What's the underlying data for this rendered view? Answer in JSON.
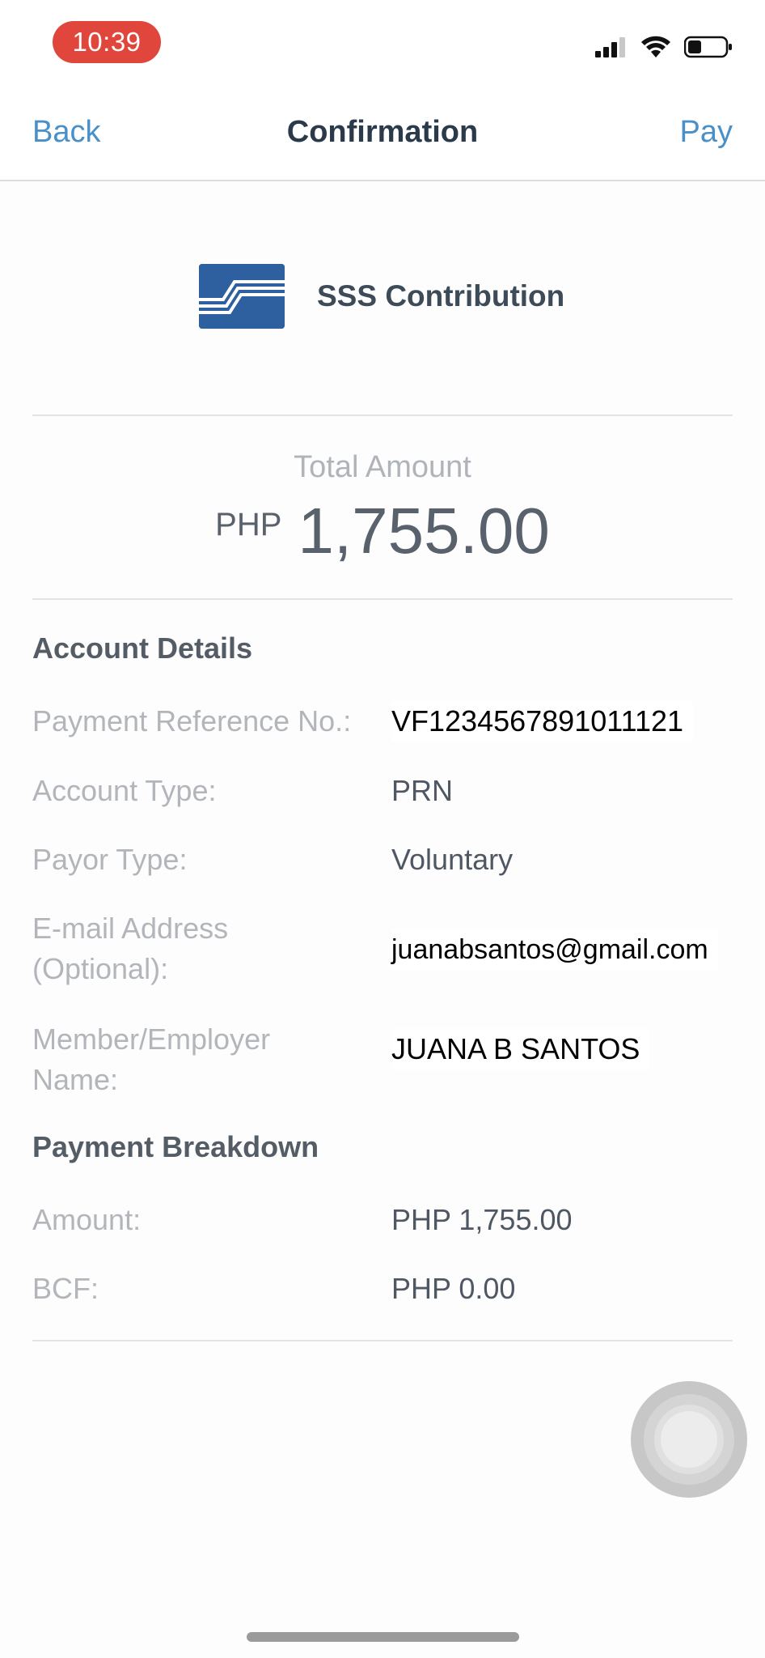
{
  "status_bar": {
    "time": "10:39",
    "icons": [
      "signal-icon",
      "wifi-icon",
      "battery-icon"
    ],
    "time_pill_color": "#e0463b"
  },
  "nav": {
    "back_label": "Back",
    "title": "Confirmation",
    "pay_label": "Pay",
    "accent_color": "#4a90c8"
  },
  "biller": {
    "name": "SSS Contribution",
    "logo": "sss-logo"
  },
  "total": {
    "label": "Total Amount",
    "currency": "PHP",
    "value": "1,755.00"
  },
  "account_details": {
    "title": "Account Details",
    "rows": [
      {
        "label": "Payment Reference No.:",
        "value": "VF1234567891011121"
      },
      {
        "label": "Account Type:",
        "value": "PRN"
      },
      {
        "label": "Payor Type:",
        "value": "Voluntary"
      },
      {
        "label_line1": "E-mail Address",
        "label_line2": "(Optional):",
        "value": "juanabsantos@gmail.com"
      },
      {
        "label_line1": "Member/Employer",
        "label_line2": "Name:",
        "value": "JUANA B SANTOS"
      }
    ]
  },
  "payment_breakdown": {
    "title": "Payment Breakdown",
    "rows": [
      {
        "label": "Amount:",
        "value": "PHP 1,755.00"
      },
      {
        "label": "BCF:",
        "value": "PHP 0.00"
      }
    ]
  }
}
